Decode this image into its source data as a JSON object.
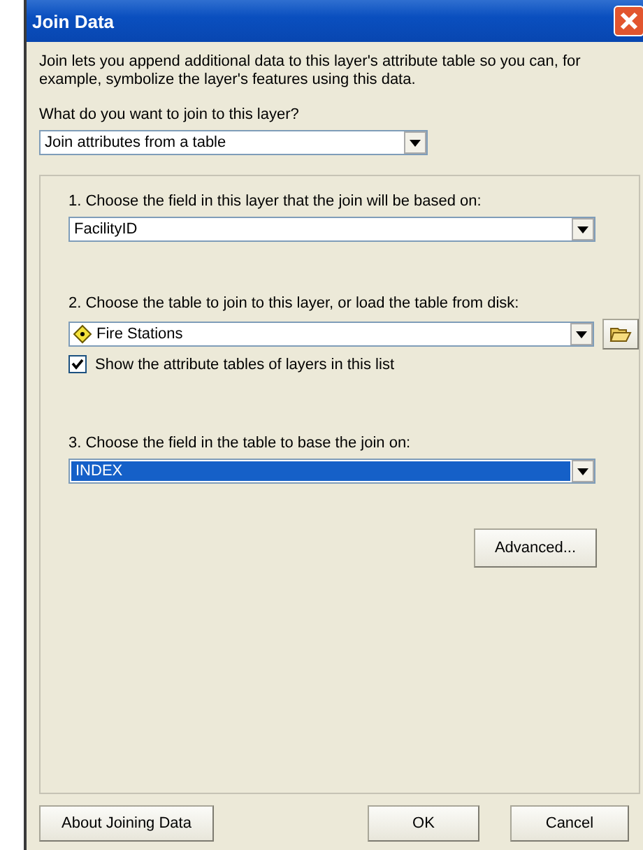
{
  "window": {
    "title": "Join Data"
  },
  "intro": "Join lets you append additional data to this layer's attribute table so you can, for example, symbolize the layer's features using this data.",
  "join_type": {
    "label": "What do you want to join to this layer?",
    "value": "Join attributes from a table"
  },
  "steps": [
    {
      "kind": "field",
      "label": "1.  Choose the field in this layer that the join will be based on:",
      "value": "FacilityID",
      "highlighted": false
    },
    {
      "kind": "table",
      "label": "2.  Choose the table to join to this layer, or load the table from disk:",
      "value": "Fire Stations",
      "highlighted": false,
      "checkbox": {
        "label": "Show the attribute tables of layers in this list",
        "checked": true
      }
    },
    {
      "kind": "field",
      "label": "3.  Choose the field in the table to base the join on:",
      "value": "INDEX",
      "highlighted": true
    }
  ],
  "advanced_button": "Advanced...",
  "buttons": [
    {
      "kind": "help",
      "label": "About Joining Data"
    },
    {
      "kind": "ok",
      "label": "OK"
    },
    {
      "kind": "cancel",
      "label": "Cancel"
    }
  ]
}
